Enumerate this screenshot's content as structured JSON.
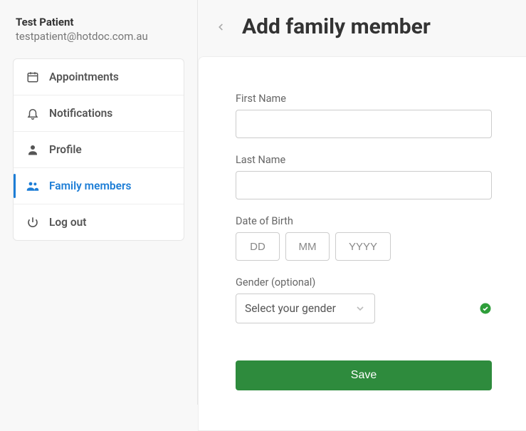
{
  "user": {
    "name": "Test Patient",
    "email": "testpatient@hotdoc.com.au"
  },
  "sidebar": {
    "items": [
      {
        "label": "Appointments"
      },
      {
        "label": "Notifications"
      },
      {
        "label": "Profile"
      },
      {
        "label": "Family members"
      },
      {
        "label": "Log out"
      }
    ]
  },
  "page": {
    "title": "Add family member"
  },
  "form": {
    "first_name_label": "First Name",
    "first_name_value": "",
    "last_name_label": "Last Name",
    "last_name_value": "",
    "dob_label": "Date of Birth",
    "dob_dd": "",
    "dob_mm": "",
    "dob_yyyy": "",
    "dob_dd_placeholder": "DD",
    "dob_mm_placeholder": "MM",
    "dob_yyyy_placeholder": "YYYY",
    "gender_label": "Gender (optional)",
    "gender_placeholder": "Select your gender",
    "gender_value": "",
    "save_label": "Save"
  }
}
